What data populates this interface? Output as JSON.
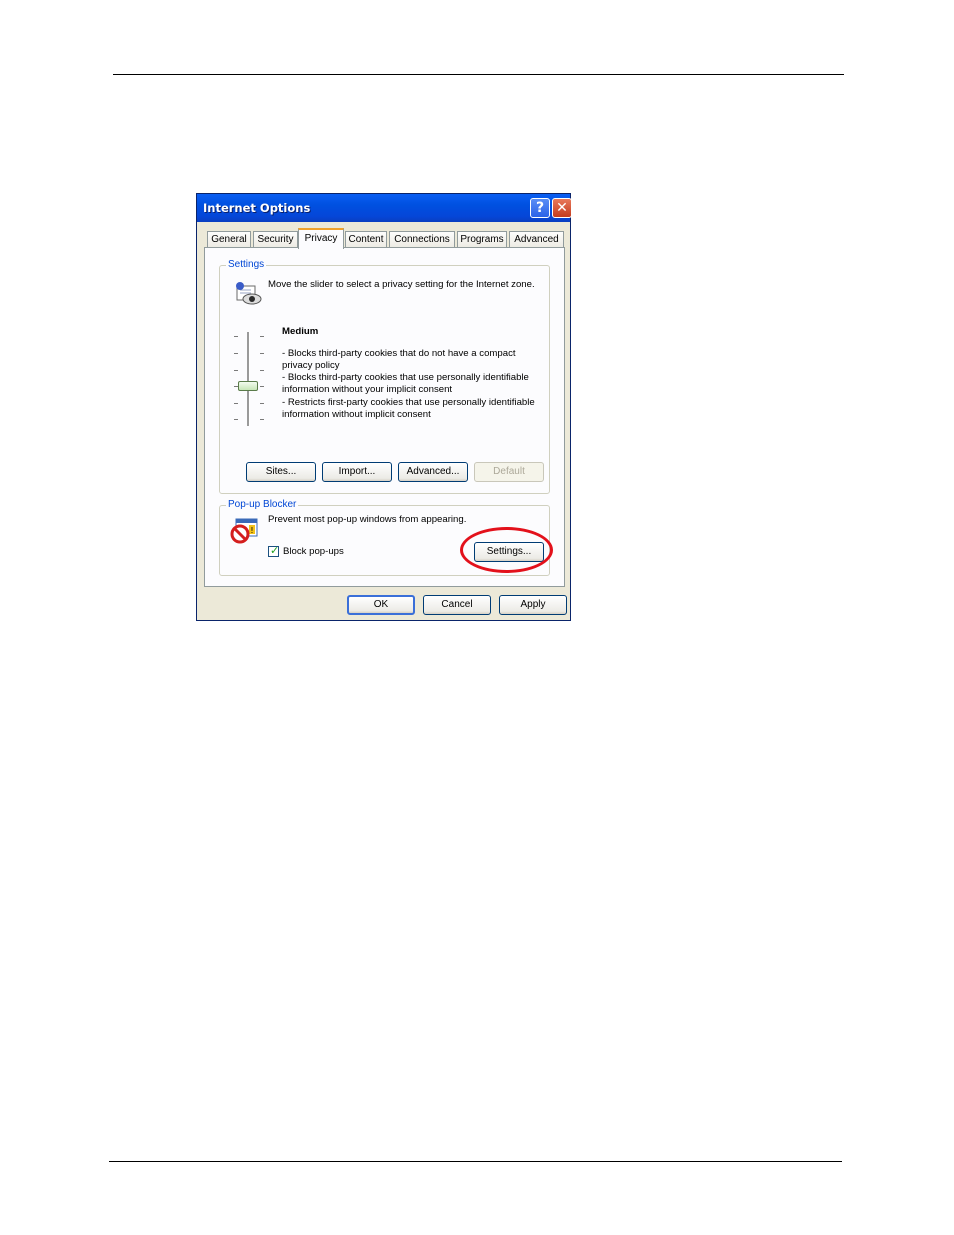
{
  "window": {
    "title": "Internet Options",
    "help_glyph": "?",
    "close_glyph": "✕"
  },
  "tabs": [
    {
      "label": "General"
    },
    {
      "label": "Security"
    },
    {
      "label": "Privacy",
      "active": true
    },
    {
      "label": "Content"
    },
    {
      "label": "Connections"
    },
    {
      "label": "Programs"
    },
    {
      "label": "Advanced"
    }
  ],
  "settings_group": {
    "label": "Settings",
    "instruction": "Move the slider to select a privacy setting for the Internet zone.",
    "level_name": "Medium",
    "slider_level": 3,
    "slider_levels": 6,
    "descriptions": [
      "- Blocks third-party cookies that do not have a compact privacy policy",
      "- Blocks third-party cookies that use personally identifiable information without your implicit consent",
      "- Restricts first-party cookies that use personally identifiable information without implicit consent"
    ],
    "buttons": {
      "sites": "Sites...",
      "import": "Import...",
      "advanced": "Advanced...",
      "default": "Default"
    }
  },
  "popup_group": {
    "label": "Pop-up Blocker",
    "description": "Prevent most pop-up windows from appearing.",
    "checkbox_label": "Block pop-ups",
    "checkbox_checked": true,
    "settings_button": "Settings..."
  },
  "footer_buttons": {
    "ok": "OK",
    "cancel": "Cancel",
    "apply": "Apply"
  },
  "colors": {
    "titlebar": "#0054e3",
    "group_label": "#0046d5",
    "highlight_ring": "#e3111b"
  },
  "icons": {
    "privacy": "privacy-icon",
    "popup_blocker": "popup-blocker-icon"
  }
}
